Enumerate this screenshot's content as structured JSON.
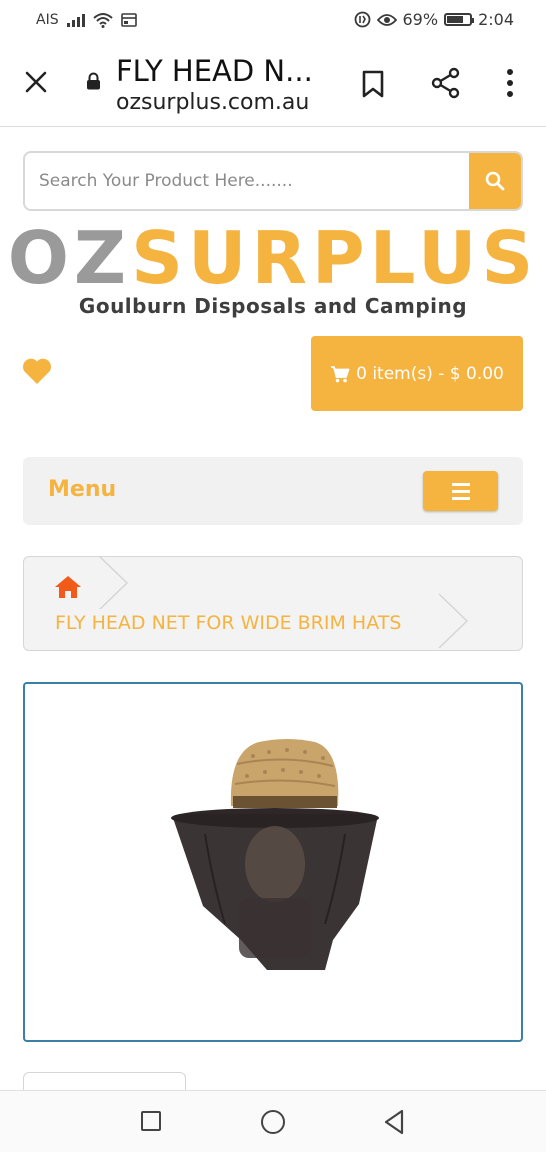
{
  "status_bar": {
    "carrier": "AIS",
    "battery": "69%",
    "time": "2:04"
  },
  "browser": {
    "title": "FLY HEAD N...",
    "domain": "ozsurplus.com.au"
  },
  "search": {
    "placeholder": "Search Your Product Here......."
  },
  "logo": {
    "part1": "OZ",
    "part2": "SURPLUS",
    "tagline": "Goulburn Disposals and Camping"
  },
  "cart": {
    "label": "0 item(s) - $ 0.00"
  },
  "menu": {
    "label": "Menu"
  },
  "breadcrumb": {
    "current": "FLY HEAD NET FOR WIDE BRIM HATS"
  },
  "colors": {
    "accent": "#f5b340",
    "home_icon": "#f25a1a",
    "frame_border": "#3a7fa5"
  }
}
